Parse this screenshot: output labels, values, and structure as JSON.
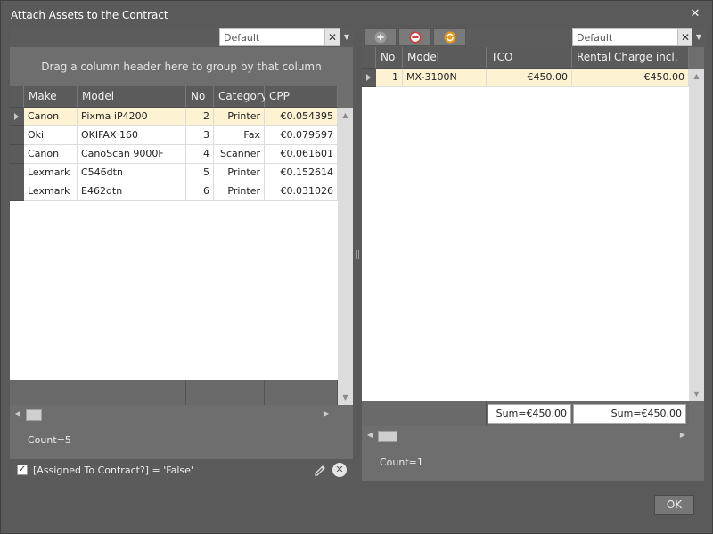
{
  "window": {
    "title": "Attach Assets to the Contract",
    "close_glyph": "✕"
  },
  "left": {
    "layout_combo": {
      "value": "Default",
      "clear_glyph": "✕",
      "drop_glyph": "▼"
    },
    "group_hint": "Drag a column header here to group by that column",
    "columns": [
      "Make",
      "Model",
      "No",
      "Category",
      "CPP"
    ],
    "rows": [
      {
        "make": "Canon",
        "model": "Pixma iP4200",
        "no": "2",
        "category": "Printer",
        "cpp": "€0.054395"
      },
      {
        "make": "Oki",
        "model": "OKIFAX 160",
        "no": "3",
        "category": "Fax",
        "cpp": "€0.079597"
      },
      {
        "make": "Canon",
        "model": "CanoScan 9000F",
        "no": "4",
        "category": "Scanner",
        "cpp": "€0.061601"
      },
      {
        "make": "Lexmark",
        "model": "C546dtn",
        "no": "5",
        "category": "Printer",
        "cpp": "€0.152614"
      },
      {
        "make": "Lexmark",
        "model": "E462dtn",
        "no": "6",
        "category": "Printer",
        "cpp": "€0.031026"
      }
    ],
    "count": "Count=5",
    "filter": {
      "checked_glyph": "✓",
      "text": "[Assigned To Contract?] = 'False'",
      "clear_glyph": "✕"
    }
  },
  "right": {
    "layout_combo": {
      "value": "Default",
      "clear_glyph": "✕",
      "drop_glyph": "▼"
    },
    "toolbar": {
      "add_icon": "plus-circle-icon",
      "remove_icon": "minus-circle-icon",
      "refresh_icon": "refresh-icon"
    },
    "columns": [
      "No",
      "Model",
      "TCO",
      "Rental Charge incl. fix"
    ],
    "rows": [
      {
        "no": "1",
        "model": "MX-3100N",
        "tco": "€450.00",
        "rental": "€450.00"
      }
    ],
    "sums": {
      "tco": "Sum=€450.00",
      "rental": "Sum=€450.00"
    },
    "count": "Count=1"
  },
  "buttons": {
    "ok": "OK"
  },
  "scroll_glyphs": {
    "up": "▲",
    "down": "▼",
    "left": "◀",
    "right": "▶"
  },
  "colors": {
    "selected_row": "#fdf3d3",
    "header": "#5b5b5b",
    "panel": "#6e6e6e",
    "accent_green": "#3aa33a",
    "accent_red": "#d23b3b",
    "accent_orange": "#e59a1c"
  }
}
